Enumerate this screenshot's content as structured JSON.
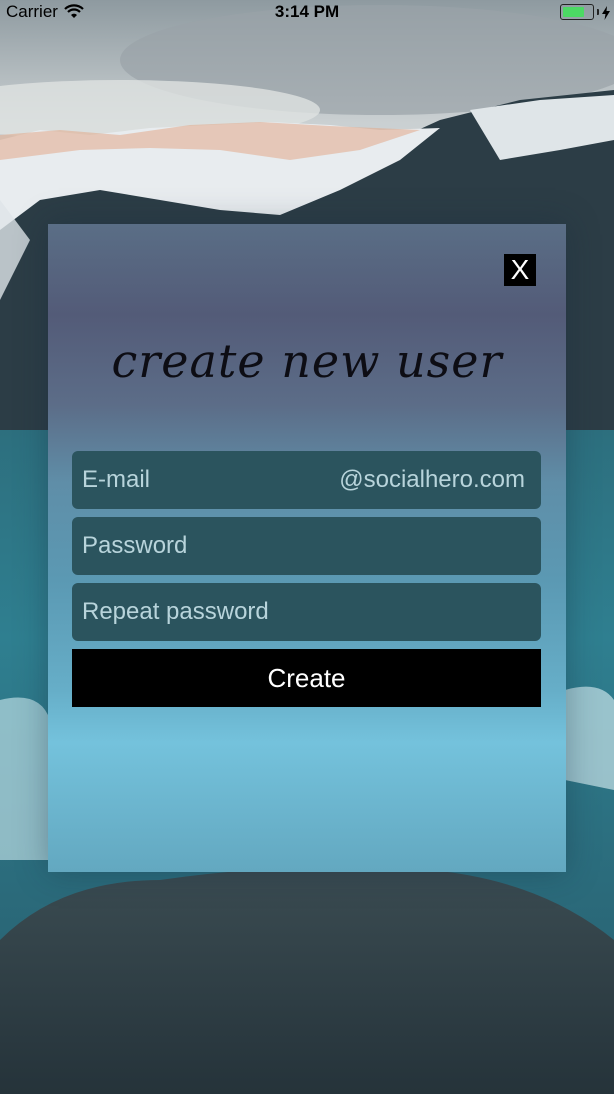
{
  "status_bar": {
    "carrier": "Carrier",
    "time": "3:14 PM",
    "battery_level": 0.75,
    "battery_color": "#4cd964"
  },
  "background": {
    "icons": [
      "mountain-landscape",
      "lake-water",
      "rock"
    ]
  },
  "modal": {
    "close_label": "X",
    "title": "create new user",
    "email_placeholder": "E-mail",
    "email_suffix": "@socialhero.com",
    "password_placeholder": "Password",
    "repeat_password_placeholder": "Repeat password",
    "create_label": "Create"
  }
}
